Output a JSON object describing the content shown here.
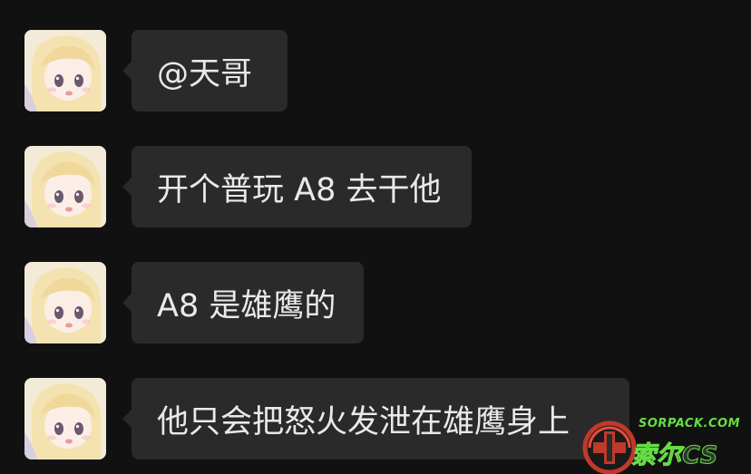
{
  "messages": [
    {
      "text": "@天哥"
    },
    {
      "text": "开个普玩 A8 去干他"
    },
    {
      "text": "A8 是雄鹰的"
    },
    {
      "text": "他只会把怒火发泄在雄鹰身上"
    }
  ],
  "watermark": {
    "site": "SORPACK.COM",
    "brand": "索尔CS"
  },
  "colors": {
    "background": "#111111",
    "bubble": "#2a2a2a",
    "text": "#e9e9e9",
    "watermark_green": "#66dd44"
  }
}
